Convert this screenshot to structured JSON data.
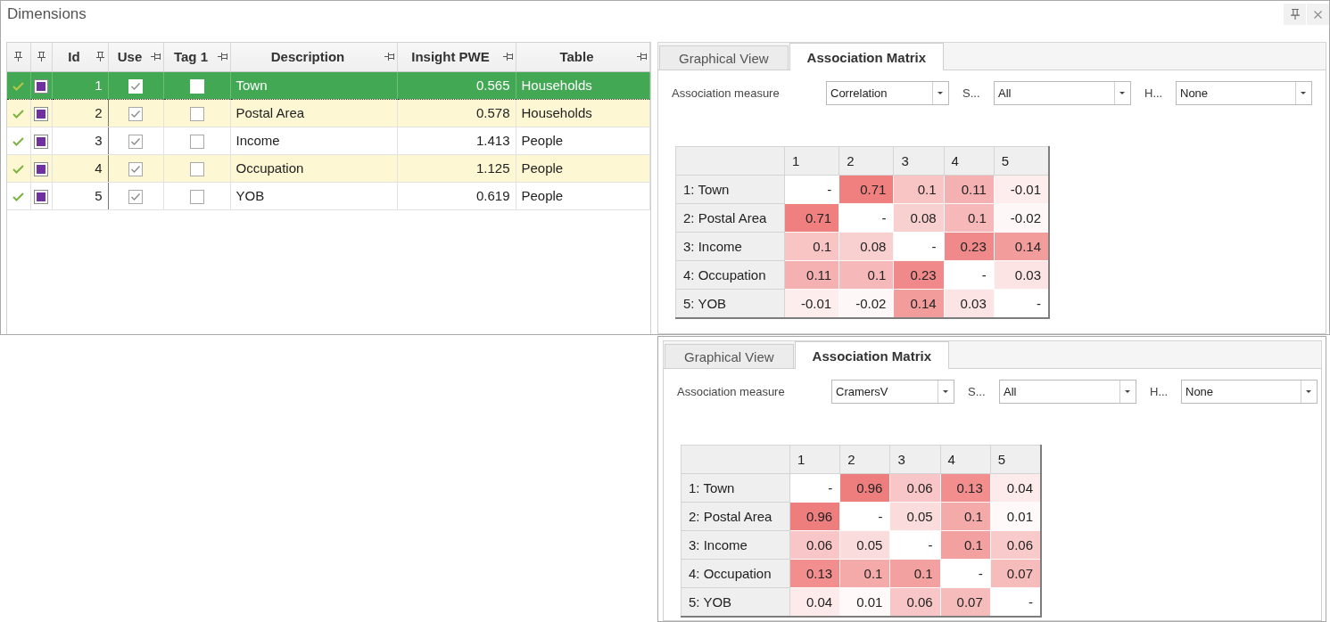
{
  "window": {
    "title": "Dimensions"
  },
  "grid": {
    "columns": [
      {
        "kind": "status",
        "pinned": true
      },
      {
        "kind": "swatch",
        "pinned": true
      },
      {
        "kind": "number",
        "label": "Id",
        "pinned": true
      },
      {
        "kind": "checkbox",
        "label": "Use",
        "pinned": false
      },
      {
        "kind": "checkbox",
        "label": "Tag 1",
        "pinned": false
      },
      {
        "kind": "text",
        "label": "Description",
        "pinned": false
      },
      {
        "kind": "number",
        "label": "Insight PWE",
        "pinned": false
      },
      {
        "kind": "text",
        "label": "Table",
        "pinned": false
      }
    ],
    "rows": [
      {
        "selected": true,
        "cells": [
          {
            "valid": true
          },
          {
            "color": "#7030a0"
          },
          {
            "text": "1"
          },
          {
            "checked": true
          },
          {
            "checked": false
          },
          {
            "text": "Town"
          },
          {
            "text": "0.565"
          },
          {
            "text": "Households"
          }
        ]
      },
      {
        "selected": false,
        "cells": [
          {
            "valid": true
          },
          {
            "color": "#7030a0"
          },
          {
            "text": "2"
          },
          {
            "checked": true
          },
          {
            "checked": false
          },
          {
            "text": "Postal Area"
          },
          {
            "text": "0.578"
          },
          {
            "text": "Households"
          }
        ]
      },
      {
        "selected": false,
        "cells": [
          {
            "valid": true
          },
          {
            "color": "#7030a0"
          },
          {
            "text": "3"
          },
          {
            "checked": true
          },
          {
            "checked": false
          },
          {
            "text": "Income"
          },
          {
            "text": "1.413"
          },
          {
            "text": "People"
          }
        ]
      },
      {
        "selected": false,
        "cells": [
          {
            "valid": true
          },
          {
            "color": "#7030a0"
          },
          {
            "text": "4"
          },
          {
            "checked": true
          },
          {
            "checked": false
          },
          {
            "text": "Occupation"
          },
          {
            "text": "1.125"
          },
          {
            "text": "People"
          }
        ]
      },
      {
        "selected": false,
        "cells": [
          {
            "valid": true
          },
          {
            "color": "#7030a0"
          },
          {
            "text": "5"
          },
          {
            "checked": true
          },
          {
            "checked": false
          },
          {
            "text": "YOB"
          },
          {
            "text": "0.619"
          },
          {
            "text": "People"
          }
        ]
      }
    ]
  },
  "matrix_panels": [
    {
      "tabs": [
        {
          "label": "Graphical View",
          "selected": false
        },
        {
          "label": "Association Matrix",
          "selected": true
        }
      ],
      "controls": [
        {
          "label": "Association measure",
          "value": "Correlation"
        },
        {
          "label": "S...",
          "value": "All"
        },
        {
          "label": "H...",
          "value": "None"
        }
      ],
      "matrix": {
        "columns": [
          "1",
          "2",
          "3",
          "4",
          "5"
        ],
        "rows": [
          {
            "label": "1: Town",
            "cells": [
              {
                "text": "-",
                "color": "#ffffff"
              },
              {
                "text": "0.71",
                "color": "#f08080"
              },
              {
                "text": "0.1",
                "color": "#f8c4c4"
              },
              {
                "text": "0.11",
                "color": "#f5b1b1"
              },
              {
                "text": "-0.01",
                "color": "#fdeded"
              }
            ]
          },
          {
            "label": "2: Postal Area",
            "cells": [
              {
                "text": "0.71",
                "color": "#f08080"
              },
              {
                "text": "-",
                "color": "#ffffff"
              },
              {
                "text": "0.08",
                "color": "#f9d0d0"
              },
              {
                "text": "0.1",
                "color": "#f6b8b8"
              },
              {
                "text": "-0.02",
                "color": "#fef7f7"
              }
            ]
          },
          {
            "label": "3: Income",
            "cells": [
              {
                "text": "0.1",
                "color": "#f8c4c4"
              },
              {
                "text": "0.08",
                "color": "#f9d0d0"
              },
              {
                "text": "-",
                "color": "#ffffff"
              },
              {
                "text": "0.23",
                "color": "#f08a8a"
              },
              {
                "text": "0.14",
                "color": "#f39c9c"
              }
            ]
          },
          {
            "label": "4: Occupation",
            "cells": [
              {
                "text": "0.11",
                "color": "#f5b1b1"
              },
              {
                "text": "0.1",
                "color": "#f6b8b8"
              },
              {
                "text": "0.23",
                "color": "#f08a8a"
              },
              {
                "text": "-",
                "color": "#ffffff"
              },
              {
                "text": "0.03",
                "color": "#fce4e4"
              }
            ]
          },
          {
            "label": "5: YOB",
            "cells": [
              {
                "text": "-0.01",
                "color": "#fdeded"
              },
              {
                "text": "-0.02",
                "color": "#fef7f7"
              },
              {
                "text": "0.14",
                "color": "#f39c9c"
              },
              {
                "text": "0.03",
                "color": "#fce4e4"
              },
              {
                "text": "-",
                "color": "#ffffff"
              }
            ]
          }
        ]
      }
    },
    {
      "tabs": [
        {
          "label": "Graphical View",
          "selected": false
        },
        {
          "label": "Association Matrix",
          "selected": true
        }
      ],
      "controls": [
        {
          "label": "Association measure",
          "value": "CramersV"
        },
        {
          "label": "S...",
          "value": "All"
        },
        {
          "label": "H...",
          "value": "None"
        }
      ],
      "matrix": {
        "columns": [
          "1",
          "2",
          "3",
          "4",
          "5"
        ],
        "rows": [
          {
            "label": "1: Town",
            "cells": [
              {
                "text": "-",
                "color": "#ffffff"
              },
              {
                "text": "0.96",
                "color": "#ee7e7e"
              },
              {
                "text": "0.06",
                "color": "#f8c6c6"
              },
              {
                "text": "0.13",
                "color": "#f28e8e"
              },
              {
                "text": "0.04",
                "color": "#fdeaea"
              }
            ]
          },
          {
            "label": "2: Postal Area",
            "cells": [
              {
                "text": "0.96",
                "color": "#ee7e7e"
              },
              {
                "text": "-",
                "color": "#ffffff"
              },
              {
                "text": "0.05",
                "color": "#fbdcdc"
              },
              {
                "text": "0.1",
                "color": "#f5aaaa"
              },
              {
                "text": "0.01",
                "color": "#fff9f9"
              }
            ]
          },
          {
            "label": "3: Income",
            "cells": [
              {
                "text": "0.06",
                "color": "#f8c6c6"
              },
              {
                "text": "0.05",
                "color": "#fbdcdc"
              },
              {
                "text": "-",
                "color": "#ffffff"
              },
              {
                "text": "0.1",
                "color": "#f3a0a0"
              },
              {
                "text": "0.06",
                "color": "#f8caca"
              }
            ]
          },
          {
            "label": "4: Occupation",
            "cells": [
              {
                "text": "0.13",
                "color": "#f28e8e"
              },
              {
                "text": "0.1",
                "color": "#f5aaaa"
              },
              {
                "text": "0.1",
                "color": "#f3a0a0"
              },
              {
                "text": "-",
                "color": "#ffffff"
              },
              {
                "text": "0.07",
                "color": "#f6bcbc"
              }
            ]
          },
          {
            "label": "5: YOB",
            "cells": [
              {
                "text": "0.04",
                "color": "#fdeaea"
              },
              {
                "text": "0.01",
                "color": "#fff9f9"
              },
              {
                "text": "0.06",
                "color": "#f8c6c6"
              },
              {
                "text": "0.07",
                "color": "#f6bcbc"
              },
              {
                "text": "-",
                "color": "#ffffff"
              }
            ]
          }
        ]
      }
    }
  ]
}
